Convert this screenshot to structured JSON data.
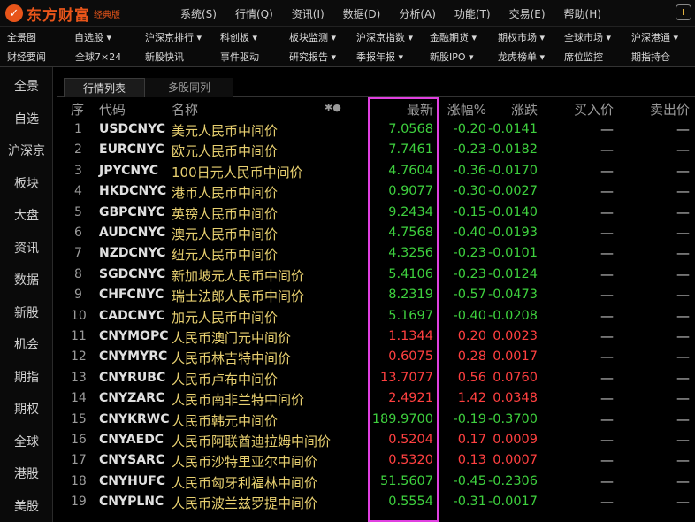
{
  "app": {
    "logo_mark": "✓",
    "logo_name": "东方财富",
    "edition": "经典版"
  },
  "menu": [
    "系统(S)",
    "行情(Q)",
    "资讯(I)",
    "数据(D)",
    "分析(A)",
    "功能(T)",
    "交易(E)",
    "帮助(H)"
  ],
  "nav_row1": [
    "全景图",
    "自选股 ▾",
    "沪深京排行 ▾",
    "科创板 ▾",
    "板块监测 ▾",
    "沪深京指数 ▾",
    "金融期货 ▾",
    "期权市场 ▾",
    "全球市场 ▾",
    "沪深港通 ▾"
  ],
  "nav_row2": [
    "财经要闻",
    "全球7×24",
    "新股快讯",
    "事件驱动",
    "研究报告 ▾",
    "季报年报 ▾",
    "新股IPO ▾",
    "龙虎榜单 ▾",
    "席位监控",
    "期指持仓"
  ],
  "sidebar": [
    "全景",
    "自选",
    "沪深京",
    "板块",
    "大盘",
    "资讯",
    "数据",
    "新股",
    "机会",
    "期指",
    "期权",
    "全球",
    "港股",
    "美股"
  ],
  "tabs": [
    "行情列表",
    "多股同列"
  ],
  "columns": {
    "seq": "序",
    "code": "代码",
    "name": "名称",
    "marker": "✱●",
    "latest": "最新",
    "change_pct": "涨幅%",
    "change": "涨跌",
    "bid": "买入价",
    "ask": "卖出价"
  },
  "rows": [
    {
      "seq": "1",
      "code": "USDCNYC",
      "name": "美元人民币中间价",
      "latest": "7.0568",
      "pct": "-0.20",
      "chg": "-0.0141",
      "bid": "—",
      "ask": "—",
      "dir": "down"
    },
    {
      "seq": "2",
      "code": "EURCNYC",
      "name": "欧元人民币中间价",
      "latest": "7.7461",
      "pct": "-0.23",
      "chg": "-0.0182",
      "bid": "—",
      "ask": "—",
      "dir": "down"
    },
    {
      "seq": "3",
      "code": "JPYCNYC",
      "name": "100日元人民币中间价",
      "latest": "4.7604",
      "pct": "-0.36",
      "chg": "-0.0170",
      "bid": "—",
      "ask": "—",
      "dir": "down"
    },
    {
      "seq": "4",
      "code": "HKDCNYC",
      "name": "港币人民币中间价",
      "latest": "0.9077",
      "pct": "-0.30",
      "chg": "-0.0027",
      "bid": "—",
      "ask": "—",
      "dir": "down"
    },
    {
      "seq": "5",
      "code": "GBPCNYC",
      "name": "英镑人民币中间价",
      "latest": "9.2434",
      "pct": "-0.15",
      "chg": "-0.0140",
      "bid": "—",
      "ask": "—",
      "dir": "down"
    },
    {
      "seq": "6",
      "code": "AUDCNYC",
      "name": "澳元人民币中间价",
      "latest": "4.7568",
      "pct": "-0.40",
      "chg": "-0.0193",
      "bid": "—",
      "ask": "—",
      "dir": "down"
    },
    {
      "seq": "7",
      "code": "NZDCNYC",
      "name": "纽元人民币中间价",
      "latest": "4.3256",
      "pct": "-0.23",
      "chg": "-0.0101",
      "bid": "—",
      "ask": "—",
      "dir": "down"
    },
    {
      "seq": "8",
      "code": "SGDCNYC",
      "name": "新加坡元人民币中间价",
      "latest": "5.4106",
      "pct": "-0.23",
      "chg": "-0.0124",
      "bid": "—",
      "ask": "—",
      "dir": "down"
    },
    {
      "seq": "9",
      "code": "CHFCNYC",
      "name": "瑞士法郎人民币中间价",
      "latest": "8.2319",
      "pct": "-0.57",
      "chg": "-0.0473",
      "bid": "—",
      "ask": "—",
      "dir": "down"
    },
    {
      "seq": "10",
      "code": "CADCNYC",
      "name": "加元人民币中间价",
      "latest": "5.1697",
      "pct": "-0.40",
      "chg": "-0.0208",
      "bid": "—",
      "ask": "—",
      "dir": "down"
    },
    {
      "seq": "11",
      "code": "CNYMOPC",
      "name": "人民币澳门元中间价",
      "latest": "1.1344",
      "pct": "0.20",
      "chg": "0.0023",
      "bid": "—",
      "ask": "—",
      "dir": "up"
    },
    {
      "seq": "12",
      "code": "CNYMYRC",
      "name": "人民币林吉特中间价",
      "latest": "0.6075",
      "pct": "0.28",
      "chg": "0.0017",
      "bid": "—",
      "ask": "—",
      "dir": "up"
    },
    {
      "seq": "13",
      "code": "CNYRUBC",
      "name": "人民币卢布中间价",
      "latest": "13.7077",
      "pct": "0.56",
      "chg": "0.0760",
      "bid": "—",
      "ask": "—",
      "dir": "up"
    },
    {
      "seq": "14",
      "code": "CNYZARC",
      "name": "人民币南非兰特中间价",
      "latest": "2.4921",
      "pct": "1.42",
      "chg": "0.0348",
      "bid": "—",
      "ask": "—",
      "dir": "up"
    },
    {
      "seq": "15",
      "code": "CNYKRWC",
      "name": "人民币韩元中间价",
      "latest": "189.9700",
      "pct": "-0.19",
      "chg": "-0.3700",
      "bid": "—",
      "ask": "—",
      "dir": "down"
    },
    {
      "seq": "16",
      "code": "CNYAEDC",
      "name": "人民币阿联酋迪拉姆中间价",
      "latest": "0.5204",
      "pct": "0.17",
      "chg": "0.0009",
      "bid": "—",
      "ask": "—",
      "dir": "up"
    },
    {
      "seq": "17",
      "code": "CNYSARC",
      "name": "人民币沙特里亚尔中间价",
      "latest": "0.5320",
      "pct": "0.13",
      "chg": "0.0007",
      "bid": "—",
      "ask": "—",
      "dir": "up"
    },
    {
      "seq": "18",
      "code": "CNYHUFC",
      "name": "人民币匈牙利福林中间价",
      "latest": "51.5607",
      "pct": "-0.45",
      "chg": "-0.2306",
      "bid": "—",
      "ask": "—",
      "dir": "down"
    },
    {
      "seq": "19",
      "code": "CNYPLNC",
      "name": "人民币波兰兹罗提中间价",
      "latest": "0.5554",
      "pct": "-0.31",
      "chg": "-0.0017",
      "bid": "—",
      "ask": "—",
      "dir": "down"
    }
  ],
  "colors": {
    "up": "#ff4040",
    "down": "#3ed03e",
    "highlight_box": "#e040e0",
    "brand": "#e8551a"
  }
}
